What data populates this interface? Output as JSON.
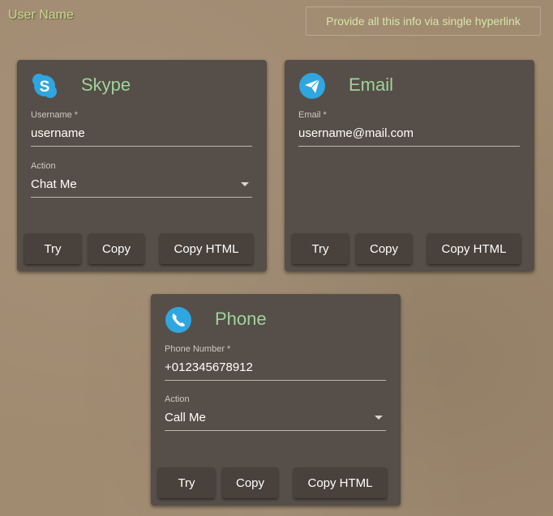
{
  "header": {
    "user_name": "User Name",
    "link_button": "Provide all this info via single hyperlink"
  },
  "cards": {
    "skype": {
      "title": "Skype",
      "icon": "skype-icon",
      "field_label": "Username *",
      "field_value": "username",
      "action_label": "Action",
      "action_value": "Chat Me",
      "try": "Try",
      "copy": "Copy",
      "copy_html": "Copy HTML"
    },
    "email": {
      "title": "Email",
      "icon": "email-icon",
      "field_label": "Email *",
      "field_value": "username@mail.com",
      "try": "Try",
      "copy": "Copy",
      "copy_html": "Copy HTML"
    },
    "phone": {
      "title": "Phone",
      "icon": "phone-icon",
      "field_label": "Phone Number *",
      "field_value": "+012345678912",
      "action_label": "Action",
      "action_value": "Call Me",
      "try": "Try",
      "copy": "Copy",
      "copy_html": "Copy HTML"
    }
  },
  "colors": {
    "card_bg": "#564e48",
    "title": "#9fd39a",
    "icon_blue": "#2fa6e0",
    "button_bg": "#48413c"
  }
}
